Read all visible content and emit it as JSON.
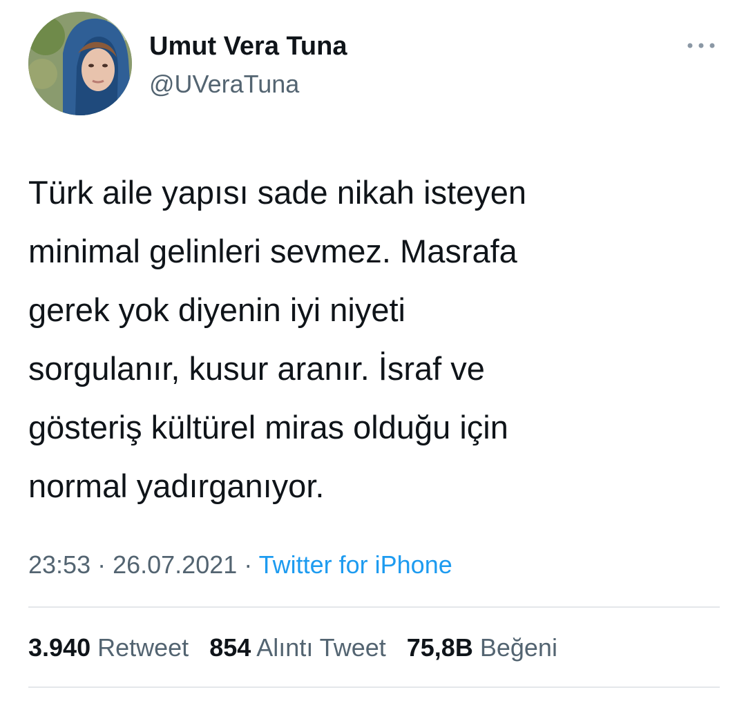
{
  "author": {
    "display_name": "Umut Vera Tuna",
    "handle": "@UVeraTuna",
    "avatar_icon": "profile-photo"
  },
  "more_icon": "more-horizontal-icon",
  "tweet": {
    "text": "Türk aile yapısı sade nikah isteyen\nminimal gelinleri sevmez. Masrafa\ngerek yok diyenin iyi niyeti\nsorgulanır, kusur aranır. İsraf ve\ngösteriş kültürel miras olduğu için\nnormal yadırganıyor."
  },
  "meta": {
    "time": "23:53",
    "separator": " · ",
    "date": "26.07.2021",
    "source": "Twitter for iPhone"
  },
  "stats": {
    "retweets_count": "3.940",
    "retweets_label": "Retweet",
    "quotes_count": "854",
    "quotes_label": "Alıntı Tweet",
    "likes_count": "75,8B",
    "likes_label": "Beğeni"
  },
  "colors": {
    "text": "#0f1419",
    "secondary": "#536471",
    "link": "#1d9bf0",
    "divider": "#e4e7ea"
  }
}
